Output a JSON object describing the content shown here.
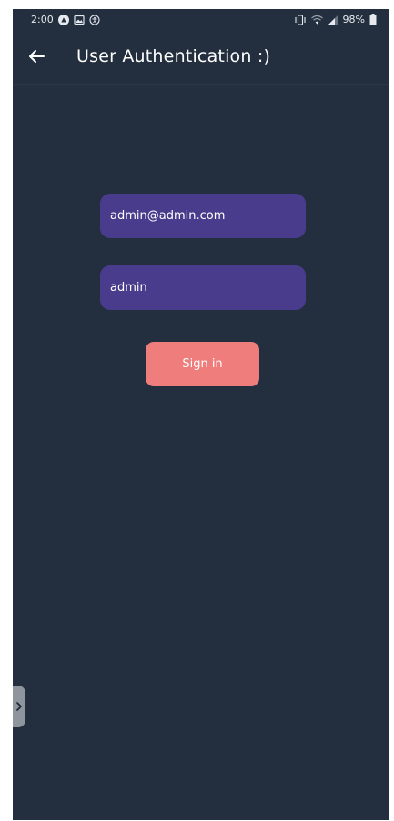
{
  "status_bar": {
    "time": "2:00",
    "battery": "98%",
    "icons": [
      "app-notification-icon",
      "gallery-icon",
      "accessibility-icon",
      "vibrate-icon",
      "wifi-icon",
      "signal-icon",
      "battery-icon"
    ]
  },
  "app_bar": {
    "back_icon": "arrow-left-icon",
    "title": "User Authentication :)"
  },
  "form": {
    "email_value": "admin@admin.com",
    "password_value": "admin",
    "signin_label": "Sign in"
  },
  "edge_handle": {
    "icon": "chevron-right-icon"
  },
  "colors": {
    "background": "#232f3e",
    "field": "#4a3c8c",
    "button": "#ef7d7b",
    "text": "#ffffff"
  }
}
